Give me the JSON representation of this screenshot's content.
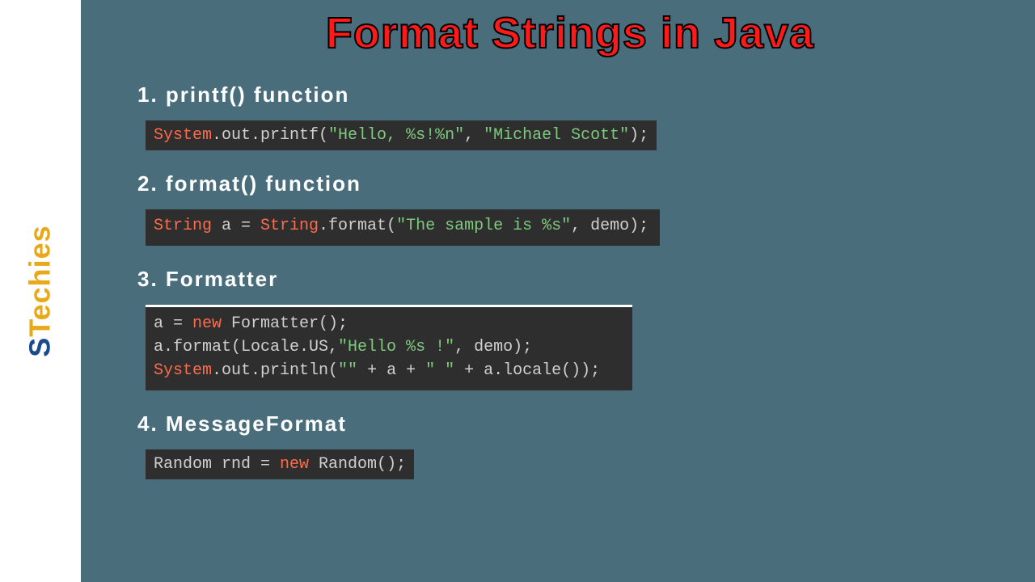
{
  "logo": {
    "first": "S",
    "rest": "Techies"
  },
  "title": "Format Strings in Java",
  "sections": [
    {
      "heading": "1. printf() function",
      "code": {
        "t1": "System",
        "t2": ".out.printf(",
        "t3": "\"Hello, %s!%n\"",
        "t4": ", ",
        "t5": "\"Michael Scott\"",
        "t6": ");"
      }
    },
    {
      "heading": "2. format() function",
      "code": {
        "t1": "String",
        "t2": " a = ",
        "t3": "String",
        "t4": ".format(",
        "t5": "\"The sample is %s\"",
        "t6": ", demo);"
      }
    },
    {
      "heading": "3. Formatter",
      "code": {
        "l1a": "a = ",
        "l1b": "new",
        "l1c": " Formatter();",
        "l2a": "a.format(Locale.US,",
        "l2b": "\"Hello %s !\"",
        "l2c": ", demo);",
        "l3a": "System",
        "l3b": ".out.println(",
        "l3c": "\"\"",
        "l3d": " + a + ",
        "l3e": "\" \"",
        "l3f": " + a.locale());"
      }
    },
    {
      "heading": "4. MessageFormat",
      "code": {
        "t1": "Random rnd = ",
        "t2": "new",
        "t3": " Random();"
      }
    }
  ]
}
